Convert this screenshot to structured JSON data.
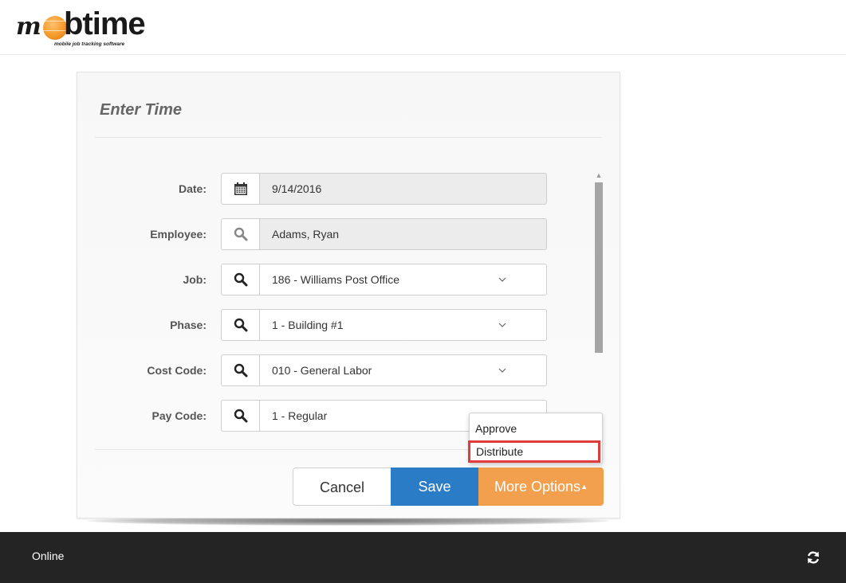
{
  "brand": {
    "logo_m": "m",
    "logo_word": "btime",
    "logo_tagline": "mobile job tracking software"
  },
  "form": {
    "title": "Enter Time",
    "fields": [
      {
        "label": "Date:",
        "value": "9/14/2016",
        "icon": "calendar-icon",
        "readonly": true,
        "dropdown": false
      },
      {
        "label": "Employee:",
        "value": "Adams, Ryan",
        "icon": "search-icon",
        "readonly": true,
        "dropdown": false
      },
      {
        "label": "Job:",
        "value": "186 - Williams Post Office",
        "icon": "search-icon",
        "readonly": false,
        "dropdown": true
      },
      {
        "label": "Phase:",
        "value": "1 - Building #1",
        "icon": "search-icon",
        "readonly": false,
        "dropdown": true
      },
      {
        "label": "Cost Code:",
        "value": "010 - General Labor",
        "icon": "search-icon",
        "readonly": false,
        "dropdown": true
      },
      {
        "label": "Pay Code:",
        "value": "1 - Regular",
        "icon": "search-icon",
        "readonly": false,
        "dropdown": true
      }
    ]
  },
  "actions": {
    "cancel": "Cancel",
    "save": "Save",
    "more": "More Options",
    "more_caret": "▲"
  },
  "more_menu": {
    "items": [
      "Approve",
      "Distribute"
    ],
    "highlighted": "Distribute"
  },
  "footer": {
    "status": "Online",
    "sync_icon": "sync-icon"
  },
  "colors": {
    "save": "#2a7cc7",
    "more": "#f2a04d",
    "highlight": "#e23b3b",
    "footer": "#242424"
  }
}
